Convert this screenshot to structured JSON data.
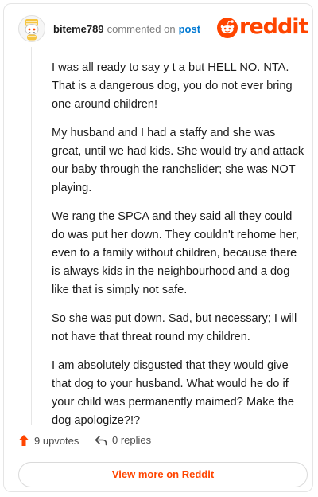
{
  "comment": {
    "username": "biteme789",
    "action_text": "commented on",
    "post_link": "post",
    "paragraphs": [
      "I was all ready to say y t a but HELL NO. NTA. That is a dangerous dog, you do not ever bring one around children!",
      "My husband and I had a staffy and she was great, until we had kids. She would try and attack our baby through the ranchslider; she was NOT playing.",
      "We rang the SPCA and they said all they could do was put her down. They couldn't rehome her, even to a family without children, because there is always kids in the neighbourhood and a dog like that is simply not safe.",
      "So she was put down. Sad, but necessary; I will not have that threat round my children.",
      "I am absolutely disgusted that they would give that dog to your husband. What would he do if your child was permanently maimed? Make the dog apologize?!?"
    ]
  },
  "brand": {
    "name": "reddit",
    "color": "#ff4500"
  },
  "actions": {
    "upvotes": "9 upvotes",
    "replies": "0 replies"
  },
  "footer": {
    "view_more": "View more on Reddit"
  },
  "icons": {
    "avatar": "snoo-avatar-icon",
    "logo": "reddit-snoo-icon",
    "upvote": "upvote-arrow-icon",
    "reply": "reply-arrow-icon"
  }
}
